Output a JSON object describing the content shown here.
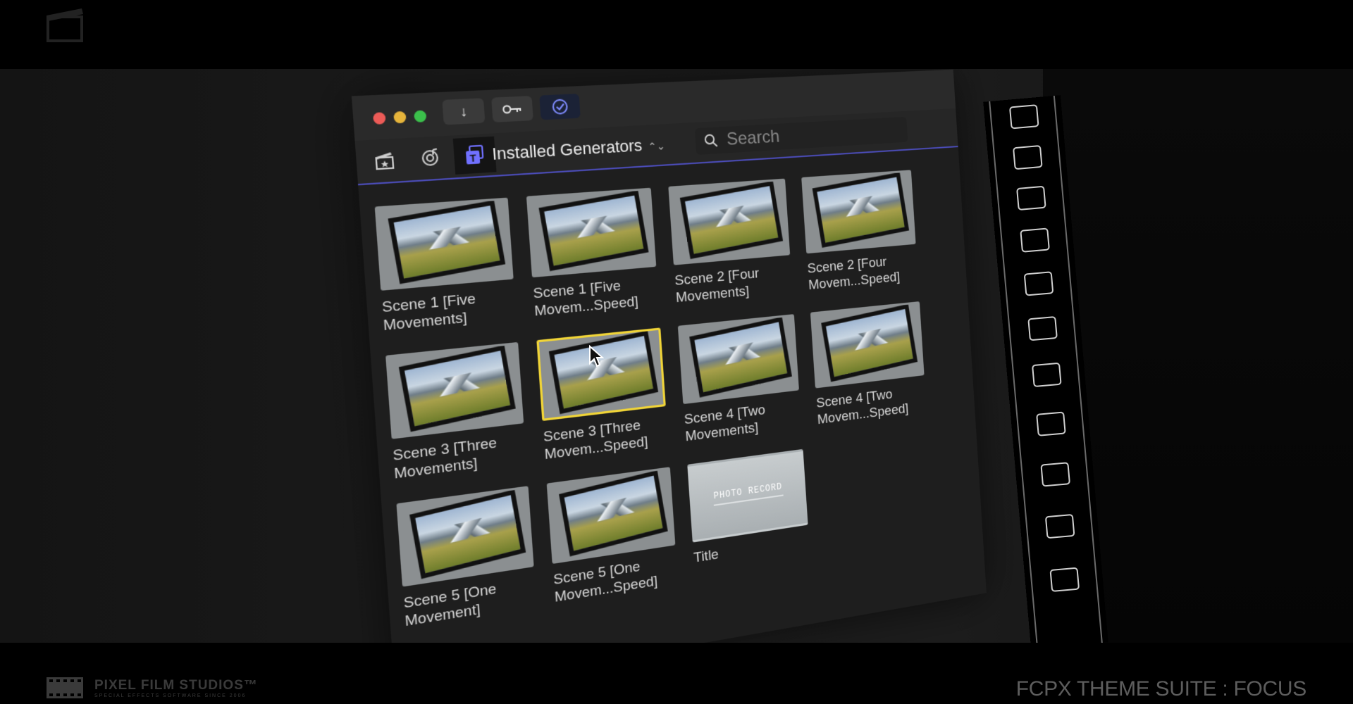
{
  "browser": {
    "title": "Installed Generators",
    "title_chevron": "⌃⌄",
    "search_placeholder": "Search",
    "toolbar": [
      {
        "icon": "download-arrow-icon",
        "glyph": "↓"
      },
      {
        "icon": "key-icon",
        "glyph": "⚿"
      },
      {
        "icon": "checkmark-circle-icon",
        "glyph": "✓",
        "active": true
      }
    ],
    "tabs": [
      {
        "icon": "clapper-star-icon",
        "glyph": "🎬"
      },
      {
        "icon": "music-camera-icon",
        "glyph": "♫"
      },
      {
        "icon": "titles-generators-icon",
        "glyph": "T",
        "active": true
      }
    ],
    "items": [
      {
        "label": "Scene 1 [Five Movements]"
      },
      {
        "label": "Scene 1 [Five Movem...Speed]"
      },
      {
        "label": "Scene 2 [Four Movements]"
      },
      {
        "label": "Scene 2 [Four Movem...Speed]"
      },
      {
        "label": "Scene 3 [Three Movements]"
      },
      {
        "label": "Scene 3 [Three Movem...Speed]",
        "selected": true
      },
      {
        "label": "Scene 4 [Two Movements]"
      },
      {
        "label": "Scene 4 [Two Movem...Speed]"
      },
      {
        "label": "Scene 5 [One Movement]"
      },
      {
        "label": "Scene 5 [One Movem...Speed]"
      },
      {
        "label": "Title",
        "is_title_card": true,
        "card_text": "PHOTO RECORD"
      }
    ]
  },
  "footer": {
    "brand": "PIXEL FILM STUDIOS™",
    "brand_tagline": "SPECIAL EFFECTS SOFTWARE SINCE 2006",
    "suite_title": "FCPX THEME SUITE : FOCUS"
  },
  "colors": {
    "accent": "#4b4cb8",
    "selection": "#f0d437"
  }
}
